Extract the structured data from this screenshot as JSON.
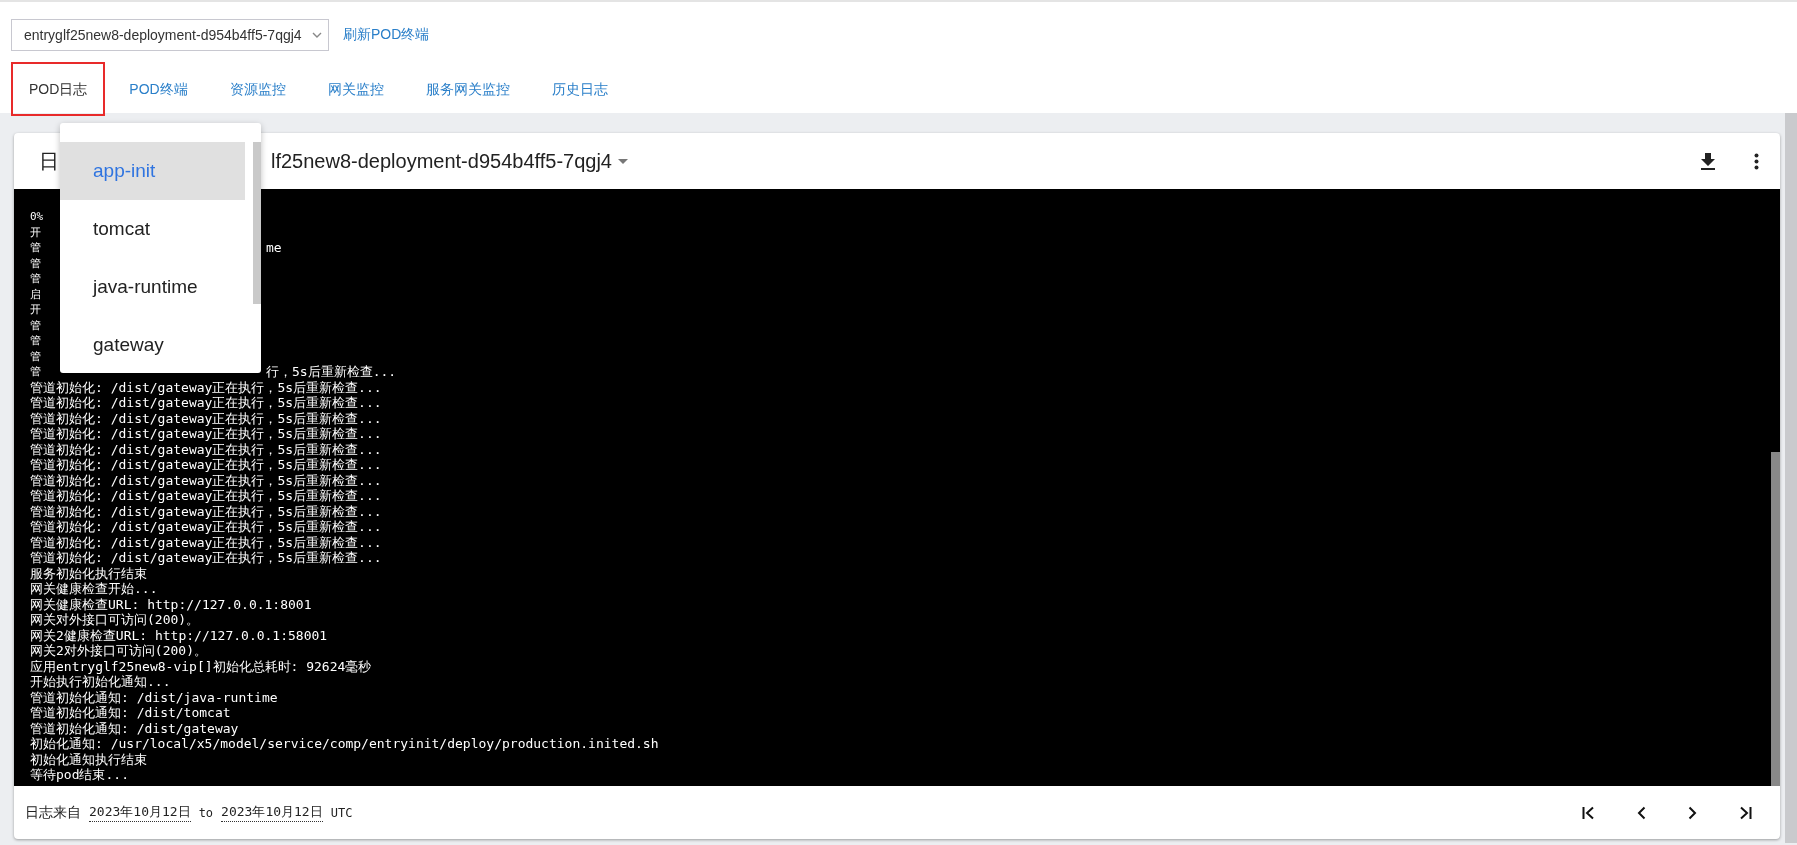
{
  "pod_select": {
    "value": "entryglf25new8-deployment-d954b4ff5-7qgj4"
  },
  "refresh_link": "刷新POD终端",
  "tabs": [
    {
      "label": "POD日志",
      "selected": true
    },
    {
      "label": "POD终端",
      "selected": false
    },
    {
      "label": "资源监控",
      "selected": false
    },
    {
      "label": "网关监控",
      "selected": false
    },
    {
      "label": "服务网关监控",
      "selected": false
    },
    {
      "label": "历史日志",
      "selected": false
    }
  ],
  "log_card": {
    "title_prefix": "日",
    "title_suffix": "lf25new8-deployment-d954b4ff5-7qgj4",
    "lines": [
      {
        "kind": "split",
        "prefix": "0%"
      },
      {
        "kind": "split",
        "prefix": "开"
      },
      {
        "kind": "split",
        "prefix": "管",
        "suffix": "me"
      },
      {
        "kind": "split",
        "prefix": "管"
      },
      {
        "kind": "split",
        "prefix": "管"
      },
      {
        "kind": "split",
        "prefix": "启"
      },
      {
        "kind": "split",
        "prefix": "开"
      },
      {
        "kind": "split",
        "prefix": "管"
      },
      {
        "kind": "split",
        "prefix": "管"
      },
      {
        "kind": "split",
        "prefix": "管"
      },
      {
        "kind": "split",
        "prefix": "管",
        "suffix": "行，5s后重新检查..."
      },
      {
        "kind": "full",
        "text": "管道初始化: /dist/gateway正在执行，5s后重新检查..."
      },
      {
        "kind": "full",
        "text": "管道初始化: /dist/gateway正在执行，5s后重新检查..."
      },
      {
        "kind": "full",
        "text": "管道初始化: /dist/gateway正在执行，5s后重新检查..."
      },
      {
        "kind": "full",
        "text": "管道初始化: /dist/gateway正在执行，5s后重新检查..."
      },
      {
        "kind": "full",
        "text": "管道初始化: /dist/gateway正在执行，5s后重新检查..."
      },
      {
        "kind": "full",
        "text": "管道初始化: /dist/gateway正在执行，5s后重新检查..."
      },
      {
        "kind": "full",
        "text": "管道初始化: /dist/gateway正在执行，5s后重新检查..."
      },
      {
        "kind": "full",
        "text": "管道初始化: /dist/gateway正在执行，5s后重新检查..."
      },
      {
        "kind": "full",
        "text": "管道初始化: /dist/gateway正在执行，5s后重新检查..."
      },
      {
        "kind": "full",
        "text": "管道初始化: /dist/gateway正在执行，5s后重新检查..."
      },
      {
        "kind": "full",
        "text": "管道初始化: /dist/gateway正在执行，5s后重新检查..."
      },
      {
        "kind": "full",
        "text": "管道初始化: /dist/gateway正在执行，5s后重新检查..."
      },
      {
        "kind": "full",
        "text": "服务初始化执行结束"
      },
      {
        "kind": "full",
        "text": "网关健康检查开始..."
      },
      {
        "kind": "full",
        "text": "网关健康检查URL: http://127.0.0.1:8001"
      },
      {
        "kind": "full",
        "text": "网关对外接口可访问(200)。"
      },
      {
        "kind": "full",
        "text": "网关2健康检查URL: http://127.0.0.1:58001"
      },
      {
        "kind": "full",
        "text": "网关2对外接口可访问(200)。"
      },
      {
        "kind": "full",
        "text": "应用entryglf25new8-vip[]初始化总耗时: 92624毫秒"
      },
      {
        "kind": "full",
        "text": "开始执行初始化通知..."
      },
      {
        "kind": "full",
        "text": "管道初始化通知: /dist/java-runtime"
      },
      {
        "kind": "full",
        "text": "管道初始化通知: /dist/tomcat"
      },
      {
        "kind": "full",
        "text": "管道初始化通知: /dist/gateway"
      },
      {
        "kind": "full",
        "text": "初始化通知: /usr/local/x5/model/service/comp/entryinit/deploy/production.inited.sh"
      },
      {
        "kind": "full",
        "text": "初始化通知执行结束"
      },
      {
        "kind": "full",
        "text": "等待pod结束..."
      }
    ],
    "footer": {
      "label": "日志来自",
      "from": "2023年10月12日",
      "to_word": "to",
      "to": "2023年10月12日",
      "zone": "UTC"
    }
  },
  "container_menu": [
    {
      "label": "app-init",
      "selected": true
    },
    {
      "label": "tomcat",
      "selected": false
    },
    {
      "label": "java-runtime",
      "selected": false
    },
    {
      "label": "gateway",
      "selected": false
    }
  ]
}
